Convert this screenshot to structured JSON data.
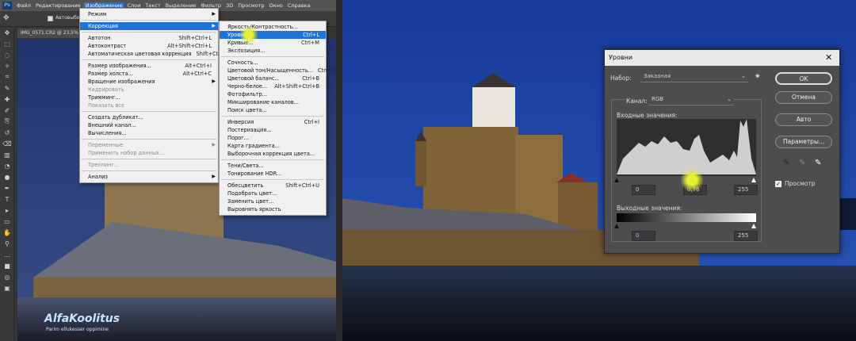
{
  "menubar": {
    "items": [
      "Файл",
      "Редактирование",
      "Изображение",
      "Слои",
      "Текст",
      "Выделение",
      "Фильтр",
      "3D",
      "Просмотр",
      "Окно",
      "Справка"
    ],
    "active_index": 2
  },
  "options": {
    "autoselect_label": "Автовыбор"
  },
  "document_tab": {
    "title": "IMG_0571.CR2 @ 23,5% ..."
  },
  "image_menu": [
    {
      "label": "Режим",
      "shortcut": "",
      "submenu": true
    },
    {
      "sep": true
    },
    {
      "label": "Коррекция",
      "shortcut": "",
      "submenu": true,
      "highlight": true
    },
    {
      "sep": true
    },
    {
      "label": "Автотон",
      "shortcut": "Shift+Ctrl+L"
    },
    {
      "label": "Автоконтраст",
      "shortcut": "Alt+Shift+Ctrl+L"
    },
    {
      "label": "Автоматическая цветовая коррекция",
      "shortcut": "Shift+Ctrl+B"
    },
    {
      "sep": true
    },
    {
      "label": "Размер изображения...",
      "shortcut": "Alt+Ctrl+I"
    },
    {
      "label": "Размер холста...",
      "shortcut": "Alt+Ctrl+C"
    },
    {
      "label": "Вращение изображения",
      "shortcut": "",
      "submenu": true
    },
    {
      "label": "Кадрировать",
      "shortcut": "",
      "disabled": true
    },
    {
      "label": "Тримминг...",
      "shortcut": ""
    },
    {
      "label": "Показать все",
      "shortcut": "",
      "disabled": true
    },
    {
      "sep": true
    },
    {
      "label": "Создать дубликат...",
      "shortcut": ""
    },
    {
      "label": "Внешний канал...",
      "shortcut": ""
    },
    {
      "label": "Вычисления...",
      "shortcut": ""
    },
    {
      "sep": true
    },
    {
      "label": "Переменные",
      "shortcut": "",
      "submenu": true,
      "disabled": true
    },
    {
      "label": "Применить набор данных...",
      "shortcut": "",
      "disabled": true
    },
    {
      "sep": true
    },
    {
      "label": "Треппинг...",
      "shortcut": "",
      "disabled": true
    },
    {
      "sep": true
    },
    {
      "label": "Анализ",
      "shortcut": "",
      "submenu": true
    }
  ],
  "adjust_menu": [
    {
      "label": "Яркость/Контрастность...",
      "shortcut": ""
    },
    {
      "label": "Уровни...",
      "shortcut": "Ctrl+L",
      "highlight": true
    },
    {
      "label": "Кривые...",
      "shortcut": "Ctrl+M"
    },
    {
      "label": "Экспозиция...",
      "shortcut": ""
    },
    {
      "sep": true
    },
    {
      "label": "Сочность...",
      "shortcut": ""
    },
    {
      "label": "Цветовой тон/Насыщенность...",
      "shortcut": "Ctrl+U"
    },
    {
      "label": "Цветовой баланс...",
      "shortcut": "Ctrl+B"
    },
    {
      "label": "Черно-белое...",
      "shortcut": "Alt+Shift+Ctrl+B"
    },
    {
      "label": "Фотофильтр...",
      "shortcut": ""
    },
    {
      "label": "Микширование каналов...",
      "shortcut": ""
    },
    {
      "label": "Поиск цвета...",
      "shortcut": ""
    },
    {
      "sep": true
    },
    {
      "label": "Инверсия",
      "shortcut": "Ctrl+I"
    },
    {
      "label": "Постеризация...",
      "shortcut": ""
    },
    {
      "label": "Порог...",
      "shortcut": ""
    },
    {
      "label": "Карта градиента...",
      "shortcut": ""
    },
    {
      "label": "Выборочная коррекция цвета...",
      "shortcut": ""
    },
    {
      "sep": true
    },
    {
      "label": "Тени/Света...",
      "shortcut": ""
    },
    {
      "label": "Тонирование HDR...",
      "shortcut": ""
    },
    {
      "sep": true
    },
    {
      "label": "Обесцветить",
      "shortcut": "Shift+Ctrl+U"
    },
    {
      "label": "Подобрать цвет...",
      "shortcut": ""
    },
    {
      "label": "Заменить цвет...",
      "shortcut": ""
    },
    {
      "label": "Выровнять яркость",
      "shortcut": ""
    }
  ],
  "levels": {
    "title": "Уровни",
    "preset_label": "Набор:",
    "preset_value": "Заказная",
    "channel_label": "Канал:",
    "channel_value": "RGB",
    "input_label": "Входные значения:",
    "input_black": "0",
    "input_gamma": "0,76",
    "input_white": "255",
    "output_label": "Выходные значения:",
    "output_black": "0",
    "output_white": "255",
    "ok": "OK",
    "cancel": "Отмена",
    "auto": "Авто",
    "options": "Параметры...",
    "preview_label": "Просмотр",
    "preview_checked": true
  },
  "watermark": {
    "brand": "AlfaKoolitus",
    "slogan": "Parim ellukesser oppimine"
  },
  "colors": {
    "accent": "#1c74d9",
    "cursor_glow": "#e6f030",
    "sky": "#1b3a8c"
  }
}
